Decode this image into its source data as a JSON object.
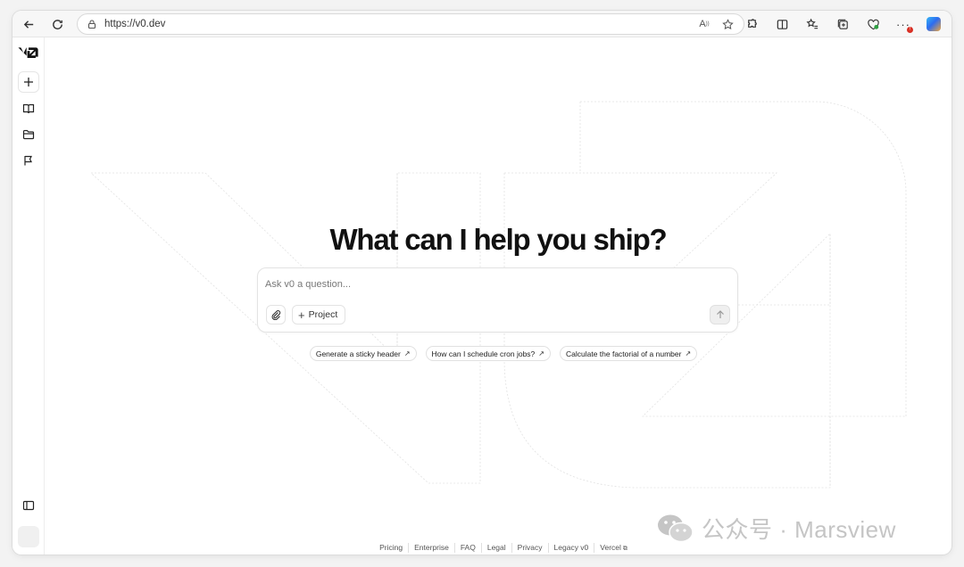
{
  "browser": {
    "url": "https://v0.dev"
  },
  "sidebar": {
    "logo": "v0"
  },
  "main": {
    "headline": "What can I help you ship?",
    "prompt": {
      "placeholder": "Ask v0 a question...",
      "value": "",
      "project_label": "Project"
    },
    "suggestions": [
      {
        "label": "Generate a sticky header"
      },
      {
        "label": "How can I schedule cron jobs?"
      },
      {
        "label": "Calculate the factorial of a number"
      }
    ]
  },
  "footer": {
    "links": [
      "Pricing",
      "Enterprise",
      "FAQ",
      "Legal",
      "Privacy",
      "Legacy v0",
      "Vercel"
    ]
  },
  "watermark": {
    "text": "公众号 · Marsview"
  },
  "icons": {
    "back": "arrow-left-icon",
    "reload": "reload-icon",
    "lock": "lock-icon",
    "read_aloud": "read-aloud-icon",
    "favorite": "star-icon",
    "extensions": "puzzle-icon",
    "split": "split-screen-icon",
    "favorites": "favorites-list-icon",
    "collections": "collections-icon",
    "performance": "heart-pulse-icon",
    "more": "more-icon",
    "copilot": "copilot-icon",
    "new_chat": "plus-icon",
    "library": "book-icon",
    "projects": "folder-icon",
    "feedback": "flag-icon",
    "panel": "sidebar-panel-icon",
    "attach": "paperclip-icon",
    "send": "arrow-up-icon"
  }
}
